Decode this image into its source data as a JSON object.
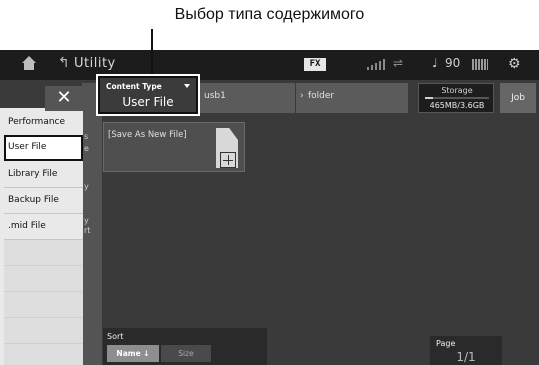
{
  "annotation": {
    "text": "Выбор типа содержимого"
  },
  "topbar": {
    "title": "Utility",
    "fx_label": "FX",
    "tempo": "90",
    "icons": [
      "home-icon",
      "up-arrow-icon",
      "meter-icon",
      "usb-icon",
      "note-icon",
      "grid-icon",
      "gear-icon"
    ]
  },
  "content_type": {
    "label": "Content Type",
    "value": "User File"
  },
  "path": {
    "device": "usb1",
    "folder": "folder"
  },
  "storage": {
    "label": "Storage",
    "value": "465MB/3.6GB",
    "used_fraction": 0.13
  },
  "job_label": "Job",
  "file_list": [
    {
      "label": "[Save As New File]"
    }
  ],
  "content_type_menu": {
    "items": [
      {
        "label": "Performance"
      },
      {
        "label": "User File"
      },
      {
        "label": "Library File"
      },
      {
        "label": "Backup File"
      },
      {
        "label": ".mid File"
      }
    ],
    "selected_index": 1
  },
  "sort": {
    "label": "Sort",
    "options": [
      "Name ↓",
      "Size"
    ],
    "selected": "Name ↓"
  },
  "page": {
    "label": "Page",
    "value": "1/1"
  },
  "colors": {
    "screen_bg": "#3a3a3a",
    "topbar_bg": "#1c1c1c",
    "menu_bg": "#e9e9e9"
  }
}
